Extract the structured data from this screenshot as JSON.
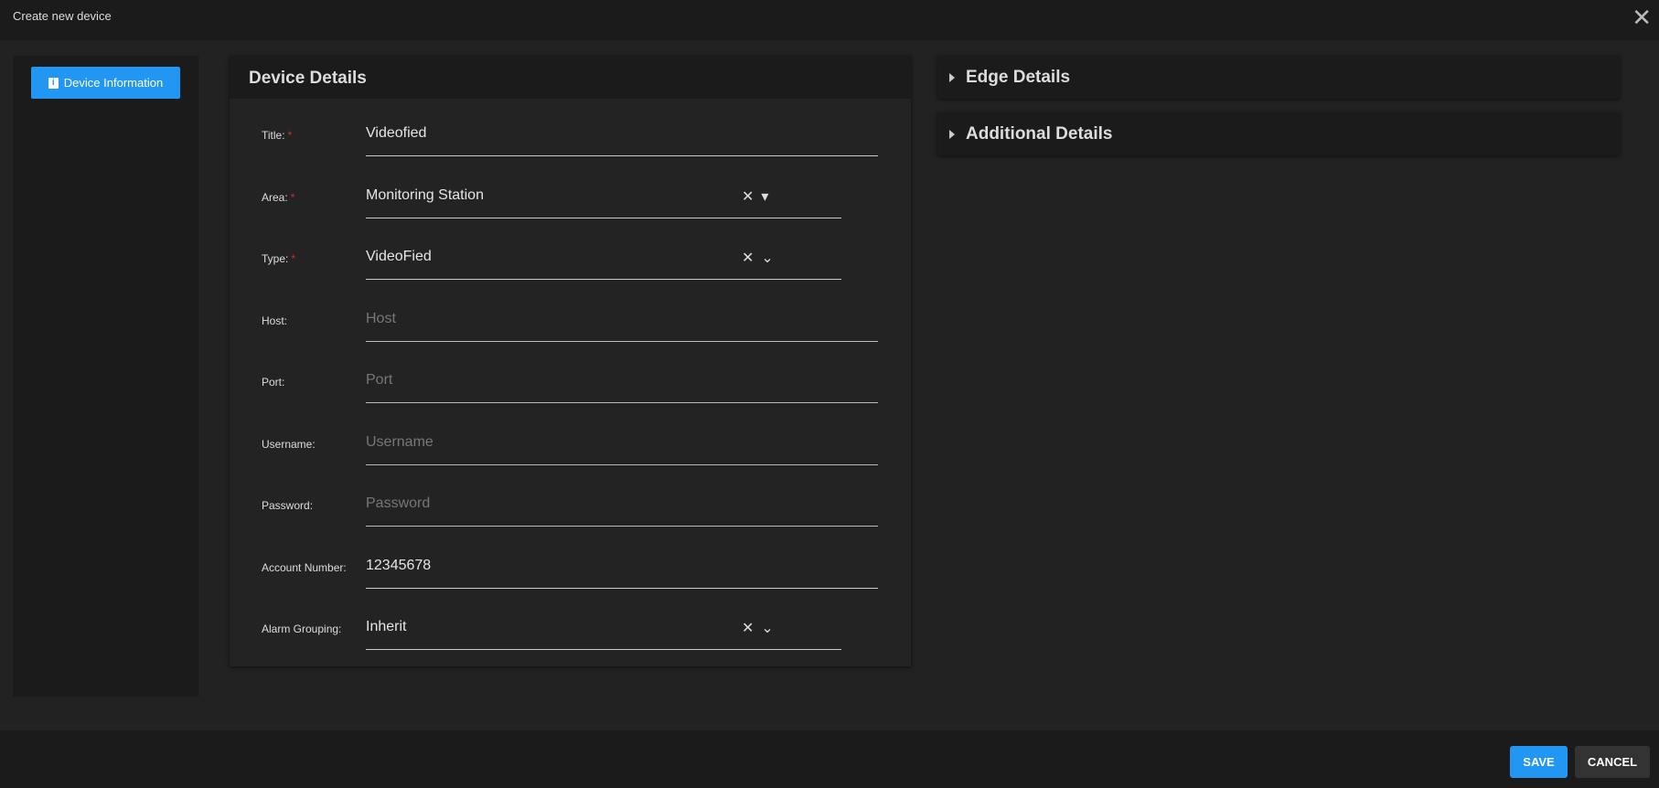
{
  "dialog": {
    "title": "Create new device"
  },
  "sidebar": {
    "items": [
      {
        "label": "Device Information",
        "icon": "info-icon"
      }
    ]
  },
  "device_details": {
    "heading": "Device Details",
    "fields": [
      {
        "label": "Title:",
        "value": "Videofied",
        "required": true
      },
      {
        "label": "Area:",
        "value": "Monitoring Station",
        "required": true
      },
      {
        "label": "Type:",
        "value": "VideoFied",
        "required": true
      },
      {
        "label": "Host:",
        "placeholder": "Host"
      },
      {
        "label": "Port:",
        "placeholder": "Port"
      },
      {
        "label": "Username:",
        "placeholder": "Username"
      },
      {
        "label": "Password:",
        "placeholder": "Password"
      },
      {
        "label": "Account Number:",
        "value": "12345678"
      },
      {
        "label": "Alarm Grouping:",
        "value": "Inherit"
      }
    ],
    "required_mark": "*",
    "clear_glyph": "✕",
    "dropdown_glyph": "▾",
    "chevron_glyph": "⌄"
  },
  "sections": [
    {
      "label": "Edge Details"
    },
    {
      "label": "Additional Details"
    }
  ],
  "footer": {
    "save": "SAVE",
    "cancel": "CANCEL"
  },
  "close_glyph": "✕"
}
